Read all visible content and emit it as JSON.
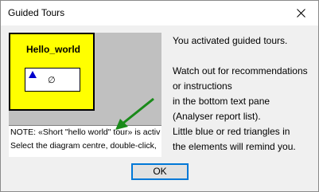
{
  "window": {
    "title": "Guided Tours",
    "close_icon": "close-icon"
  },
  "preview": {
    "element_title": "Hello_world",
    "null_symbol": "∅",
    "marker_color": "#0000cc",
    "element_fill": "#ffff00",
    "report_lines": [
      "NOTE: «Short \"hello world\" tour» is activ",
      "Select the diagram centre, double-click,"
    ],
    "arrow_color": "#1a8a1a"
  },
  "message": {
    "lines": [
      "You activated guided tours.",
      "",
      "Watch out for recommendations",
      "or instructions",
      "in the bottom text pane",
      "(Analyser report list).",
      "Little blue or red triangles in",
      "the elements will remind you."
    ]
  },
  "buttons": {
    "ok_label": "OK"
  }
}
